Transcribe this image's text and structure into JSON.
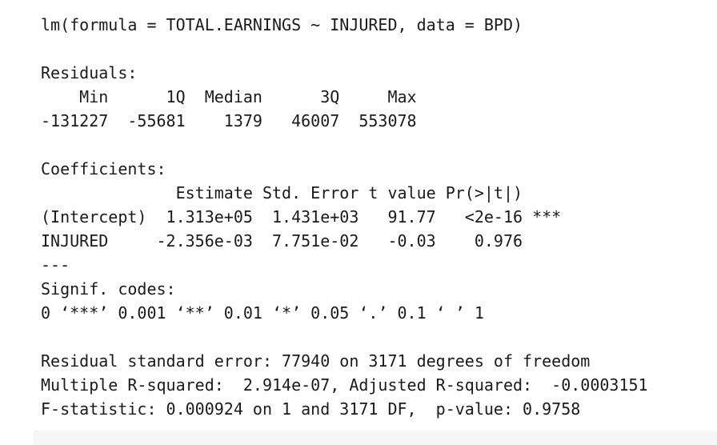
{
  "output": {
    "call": "lm(formula = TOTAL.EARNINGS ~ INJURED, data = BPD)",
    "residuals_header": "Residuals:",
    "residuals_labels": "    Min      1Q  Median      3Q     Max ",
    "residuals_values": "-131227  -55681    1379   46007  553078 ",
    "coef_header": "Coefficients:",
    "coef_columns": "              Estimate Std. Error t value Pr(>|t|)    ",
    "coef_rows": [
      "(Intercept)  1.313e+05  1.431e+03   91.77   <2e-16 ***",
      "INJURED     -2.356e-03  7.751e-02   -0.03    0.976    "
    ],
    "separator": "---",
    "signif_header": "Signif. codes:",
    "signif_codes": "0 ‘***’ 0.001 ‘**’ 0.01 ‘*’ 0.05 ‘.’ 0.1 ‘ ’ 1",
    "rse": "Residual standard error: 77940 on 3171 degrees of freedom",
    "r_squared": "Multiple R-squared:  2.914e-07, Adjusted R-squared:  -0.0003151 ",
    "f_statistic": "F-statistic: 0.000924 on 1 and 3171 DF,  p-value: 0.9758"
  },
  "colors": {
    "text": "#1a1a1a",
    "background": "#ffffff",
    "strip": "#f6f6f6"
  }
}
